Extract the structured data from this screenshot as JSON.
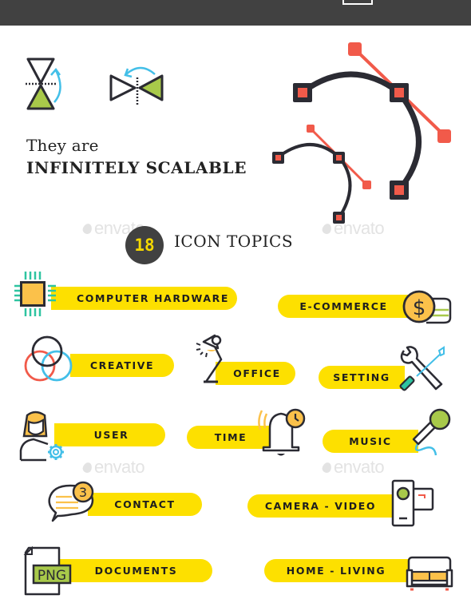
{
  "header": {
    "bar_color": "#414141"
  },
  "hero": {
    "line1": "They are",
    "line2": "INFINITELY SCALABLE",
    "icons": [
      "flip-vertical-icon",
      "flip-horizontal-icon",
      "bezier-curve-large-icon",
      "bezier-curve-small-icon"
    ]
  },
  "topics": {
    "count": "18",
    "title": "ICON TOPICS"
  },
  "watermark": {
    "text": "envato"
  },
  "colors": {
    "yellow": "#fde000",
    "dark": "#2b2b33",
    "red": "#f15a4a",
    "green": "#a8c94a",
    "blue": "#43bfe8",
    "orange": "#fbc14a",
    "teal": "#2ec4a0"
  },
  "categories": [
    {
      "label": "COMPUTER HARDWARE",
      "icon": "cpu-chip-icon"
    },
    {
      "label": "E-COMMERCE",
      "icon": "dollar-coin-icon"
    },
    {
      "label": "CREATIVE",
      "icon": "venn-circles-icon"
    },
    {
      "label": "OFFICE",
      "icon": "desk-lamp-icon"
    },
    {
      "label": "SETTING",
      "icon": "wrench-screwdriver-icon"
    },
    {
      "label": "USER",
      "icon": "user-gear-icon"
    },
    {
      "label": "TIME",
      "icon": "bell-clock-icon"
    },
    {
      "label": "MUSIC",
      "icon": "microphone-icon"
    },
    {
      "label": "CONTACT",
      "icon": "chat-bubble-icon",
      "badge": "3"
    },
    {
      "label": "CAMERA - VIDEO",
      "icon": "video-camera-icon"
    },
    {
      "label": "DOCUMENTS",
      "icon": "png-file-icon",
      "badge": "PNG"
    },
    {
      "label": "HOME - LIVING",
      "icon": "sofa-icon"
    }
  ]
}
